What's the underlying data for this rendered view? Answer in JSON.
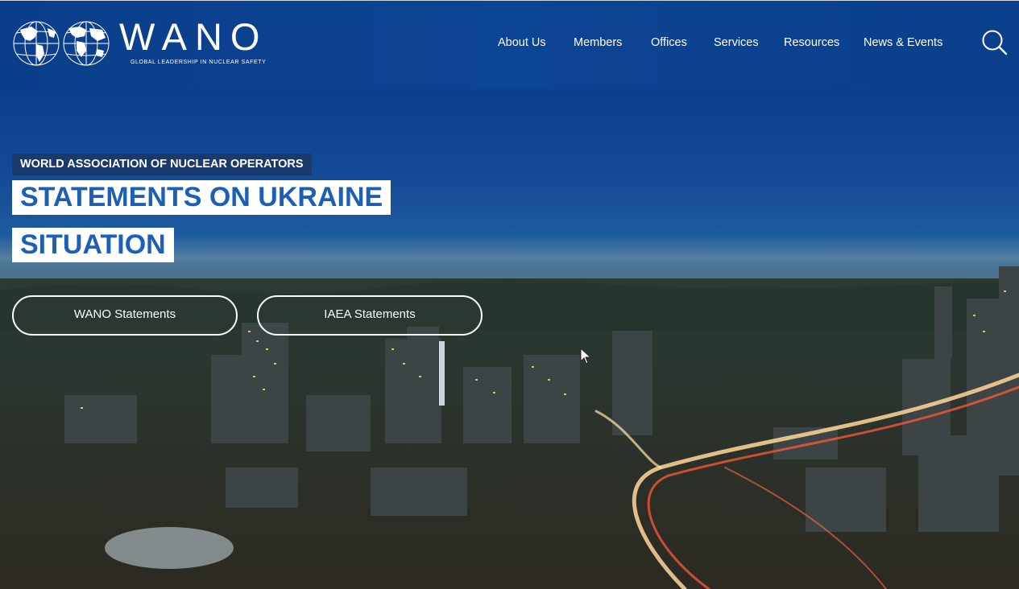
{
  "logo": {
    "name": "WANO",
    "tagline": "GLOBAL LEADERSHIP IN NUCLEAR SAFETY"
  },
  "nav": {
    "items": [
      "About Us",
      "Members",
      "Offices",
      "Services",
      "Resources",
      "News & Events"
    ],
    "search_icon": "search-icon"
  },
  "hero": {
    "eyebrow": "WORLD ASSOCIATION OF NUCLEAR OPERATORS",
    "title_line1": "STATEMENTS ON UKRAINE",
    "title_line2": "SITUATION",
    "buttons": [
      "WANO Statements",
      "IAEA Statements"
    ]
  },
  "colors": {
    "header_bg": "#0c4594",
    "eyebrow_bg": "#1b3a6c",
    "title_text": "#1d5fb4",
    "button_border": "#ffffff"
  }
}
